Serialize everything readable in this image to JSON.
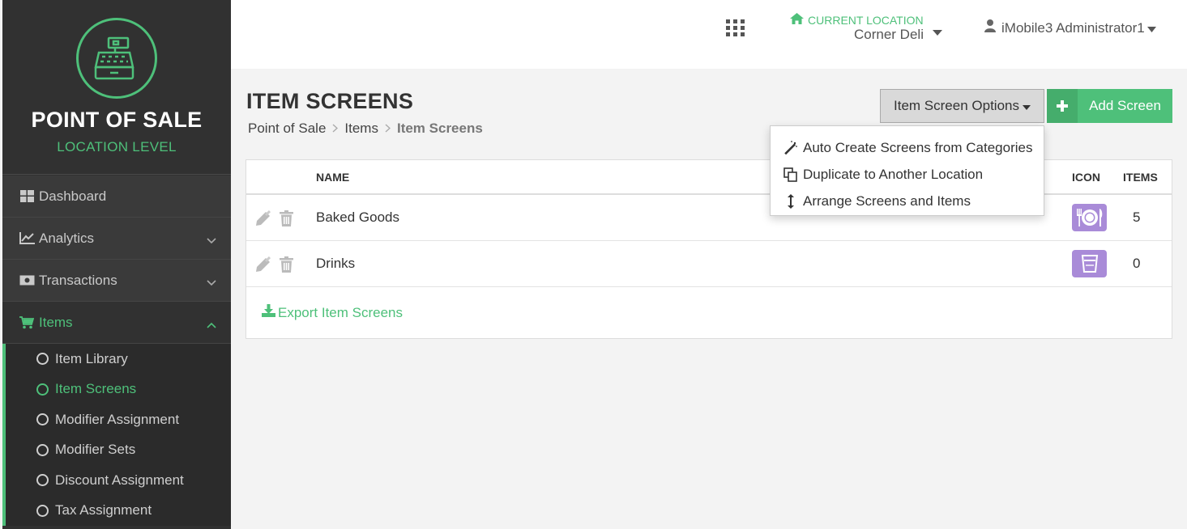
{
  "sidebar": {
    "brand_title": "POINT OF SALE",
    "brand_subtitle": "LOCATION LEVEL",
    "nav": [
      {
        "label": "Dashboard",
        "icon": "dashboard-icon"
      },
      {
        "label": "Analytics",
        "icon": "line-chart-icon"
      },
      {
        "label": "Transactions",
        "icon": "money-icon"
      },
      {
        "label": "Items",
        "icon": "cart-icon"
      }
    ],
    "sub_items": [
      {
        "label": "Item Library"
      },
      {
        "label": "Item Screens"
      },
      {
        "label": "Modifier Assignment"
      },
      {
        "label": "Modifier Sets"
      },
      {
        "label": "Discount Assignment"
      },
      {
        "label": "Tax Assignment"
      }
    ]
  },
  "topbar": {
    "location_label": "CURRENT LOCATION",
    "location_value": "Corner Deli",
    "user_name": "iMobile3 Administrator1"
  },
  "header": {
    "title": "ITEM SCREENS",
    "breadcrumb": [
      "Point of Sale",
      "Items",
      "Item Screens"
    ],
    "options_button": "Item Screen Options",
    "add_button": "Add Screen"
  },
  "dropdown": {
    "items": [
      {
        "label": "Auto Create Screens from Categories",
        "icon": "magic-wand-icon"
      },
      {
        "label": "Duplicate to Another Location",
        "icon": "copy-icon"
      },
      {
        "label": "Arrange Screens and Items",
        "icon": "vertical-arrows-icon"
      }
    ]
  },
  "table": {
    "headers": {
      "name": "NAME",
      "icon": "ICON",
      "items": "ITEMS"
    },
    "rows": [
      {
        "name": "Baked Goods",
        "icon": "plate-utensils-icon",
        "items": "5"
      },
      {
        "name": "Drinks",
        "icon": "cup-icon",
        "items": "0"
      }
    ],
    "export_label": "Export Item Screens"
  },
  "colors": {
    "accent": "#4ec07a",
    "sidebar_bg": "#313131",
    "icon_bg": "#a98bd8"
  }
}
